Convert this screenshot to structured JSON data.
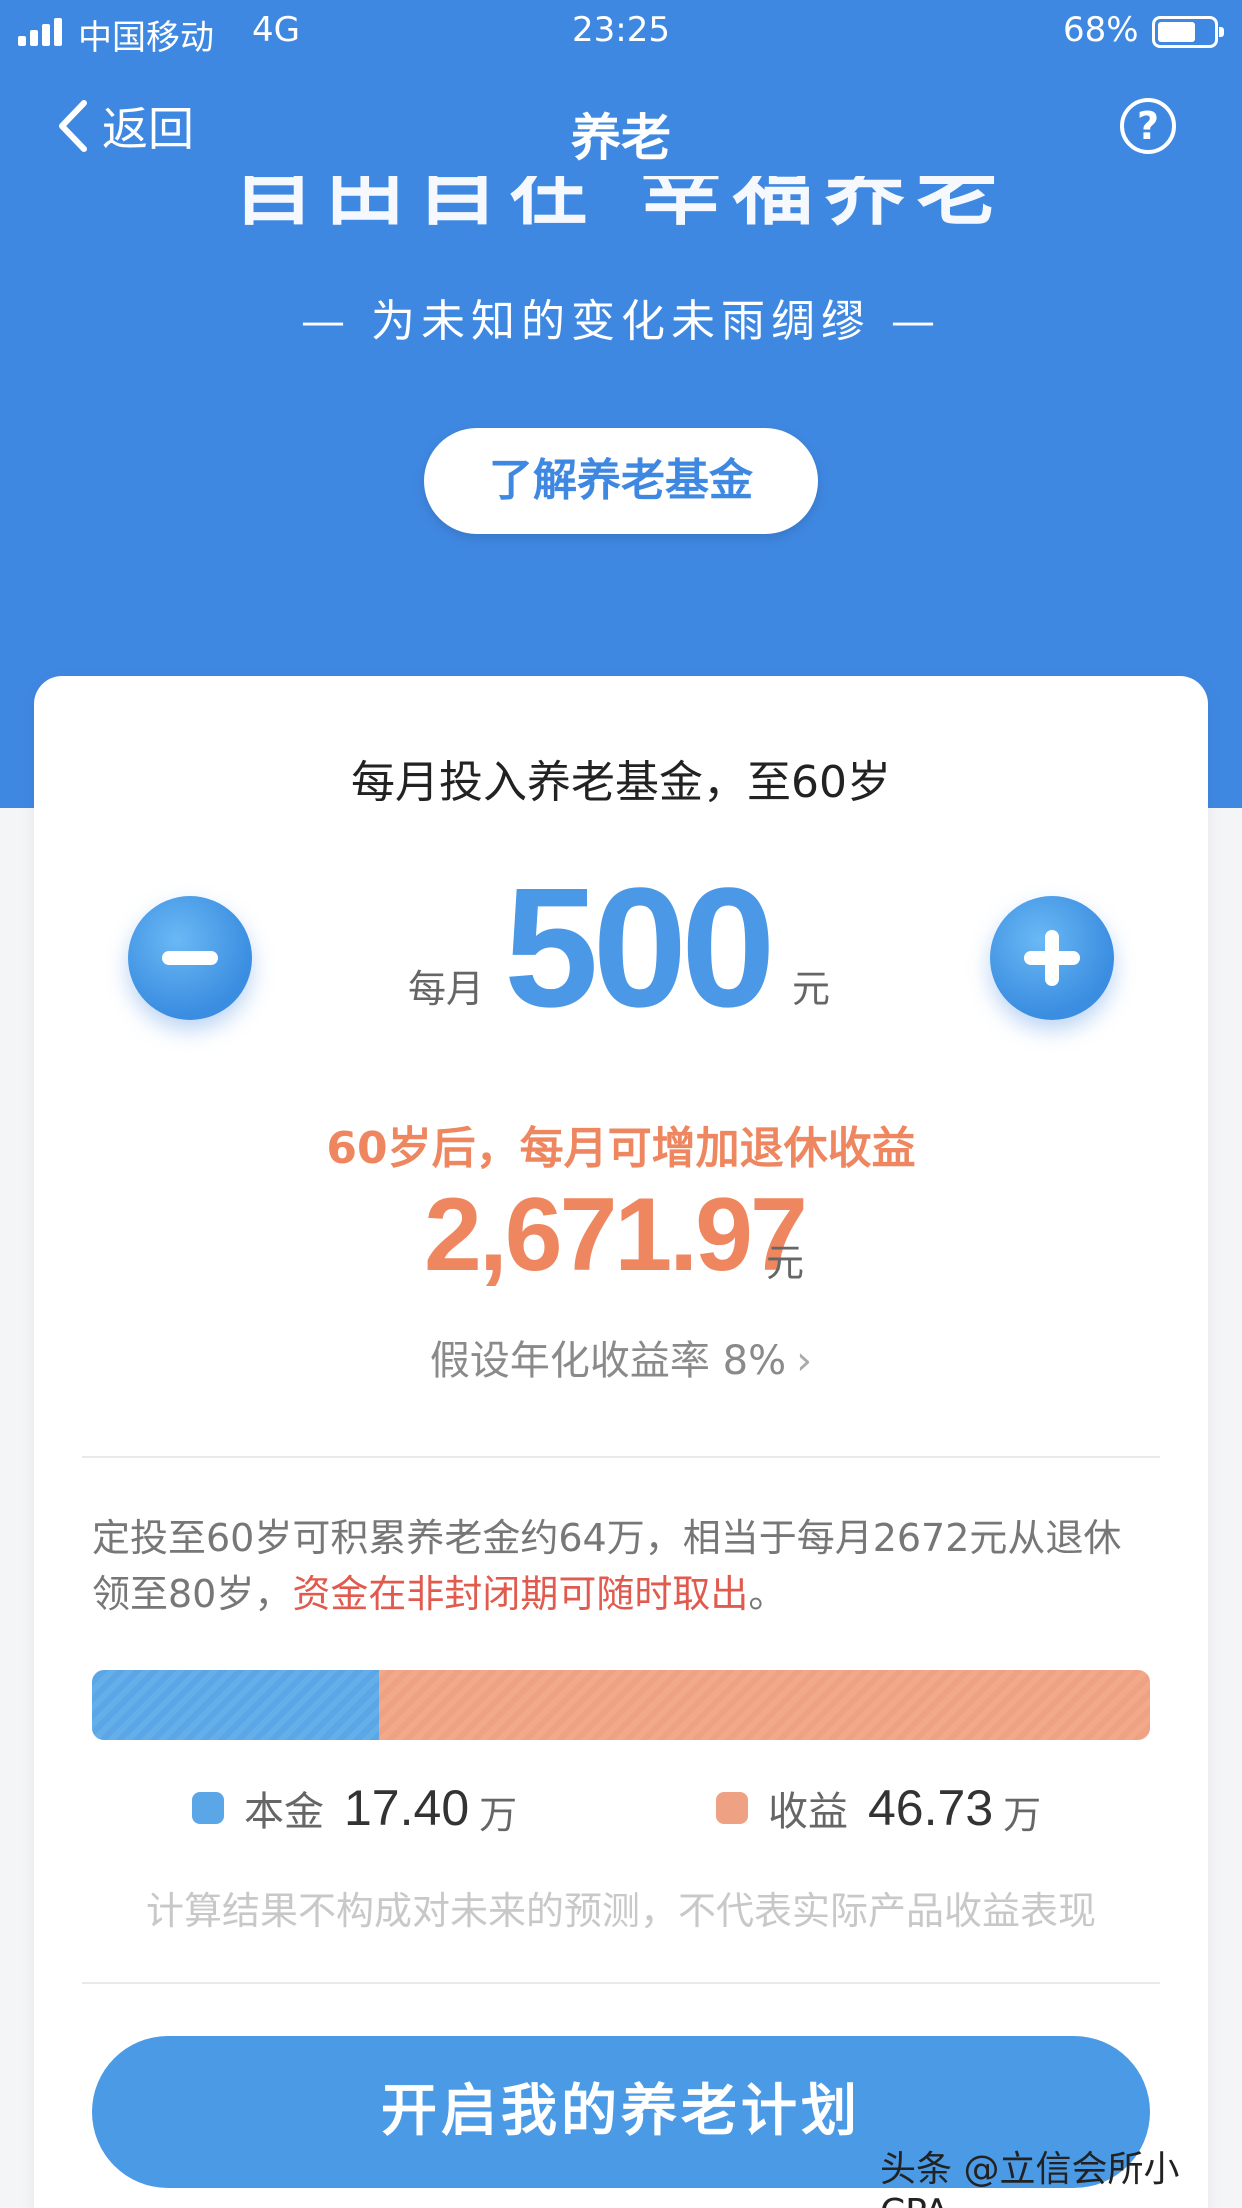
{
  "status_bar": {
    "carrier": "中国移动",
    "network": "4G",
    "time": "23:25",
    "battery": "68%",
    "battery_level": 0.68
  },
  "nav": {
    "back_label": "返回",
    "title": "养老",
    "help_label": "?"
  },
  "hero": {
    "slogan": "自由自在 幸福养老",
    "subtitle": "— 为未知的变化未雨绸缪 —",
    "learn_button": "了解养老基金"
  },
  "calculator": {
    "heading": "每月投入养老基金，至60岁",
    "amount_prefix": "每月",
    "amount": "500",
    "amount_unit": "元",
    "gain_label": "60岁后，每月可增加退休收益",
    "gain_value": "2,671.97",
    "gain_unit": "元",
    "rate_text": "假设年化收益率 8%",
    "rate_chevron": "›"
  },
  "summary": {
    "desc_plain": "定投至60岁可积累养老金约64万，相当于每月2672元从退休领至80岁，",
    "desc_highlight": "资金在非封闭期可随时取出",
    "desc_end": "。",
    "principal_label": "本金",
    "principal_value": "17.40",
    "principal_unit": "万",
    "earnings_label": "收益",
    "earnings_value": "46.73",
    "earnings_unit": "万",
    "principal_share": 0.2713,
    "disclaimer": "计算结果不构成对未来的预测，不代表实际产品收益表现"
  },
  "cta": {
    "label": "开启我的养老计划"
  },
  "watermark": "头条 @立信会所小CPA",
  "colors": {
    "primary": "#3f88e2",
    "accent_orange": "#ee8760",
    "highlight_red": "#e05a4e",
    "principal": "#5aa6e6",
    "earnings": "#eea283"
  },
  "icons": {
    "back": "chevron-left-icon",
    "help": "question-circle-icon",
    "minus": "minus-icon",
    "plus": "plus-icon",
    "rate": "chevron-right-icon"
  }
}
